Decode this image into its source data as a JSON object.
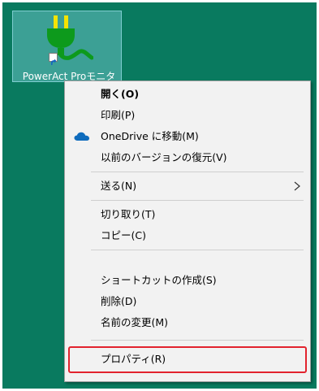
{
  "desktop": {
    "background_color": "#097a5f",
    "shortcut": {
      "label": "PowerAct Proモニタ",
      "icon": "power-plug-icon",
      "overlay_icon": "shortcut-arrow-icon"
    }
  },
  "context_menu": {
    "items": [
      {
        "label": "開く(O)",
        "bold": true
      },
      {
        "label": "印刷(P)"
      },
      {
        "label": "OneDrive に移動(M)",
        "icon": "onedrive-cloud-icon"
      },
      {
        "label": "以前のバージョンの復元(V)"
      },
      {
        "label": "送る(N)",
        "submenu": true
      },
      {
        "label": "切り取り(T)"
      },
      {
        "label": "コピー(C)"
      },
      {
        "label": "ショートカットの作成(S)"
      },
      {
        "label": "削除(D)"
      },
      {
        "label": "名前の変更(M)"
      },
      {
        "label": "プロパティ(R)",
        "highlighted": true
      }
    ],
    "highlight_color": "#e2232e",
    "onedrive_color": "#0f6cbd"
  }
}
